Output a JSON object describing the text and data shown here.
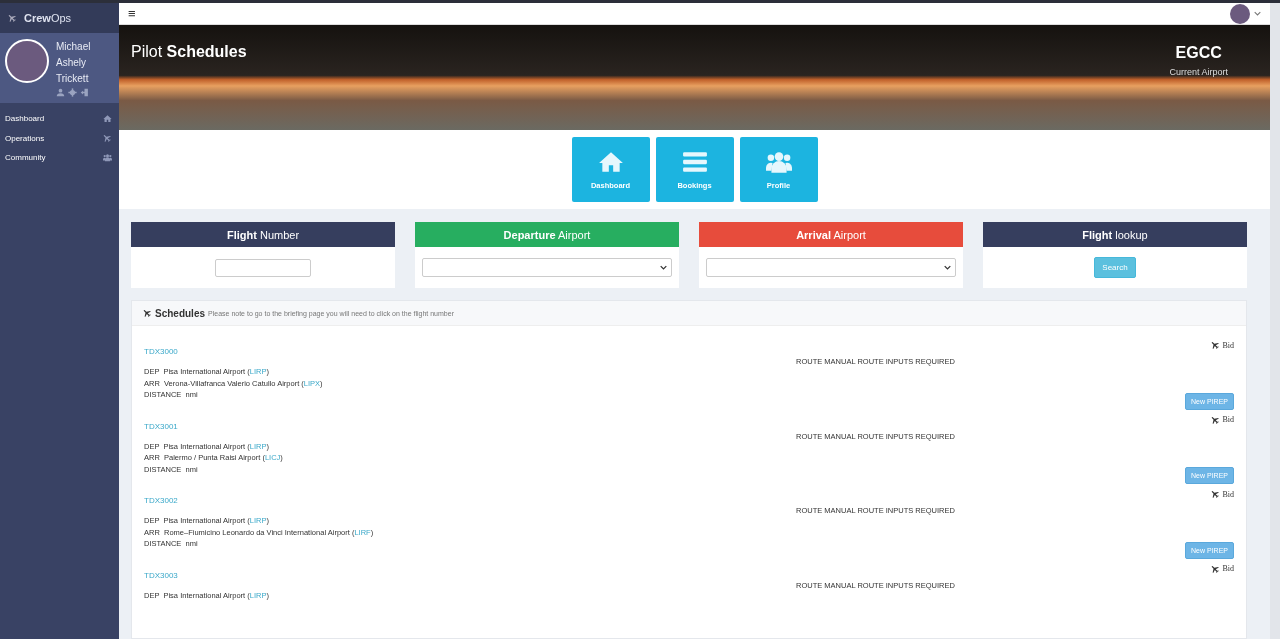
{
  "sidebar": {
    "brand": "**Crew**Ops",
    "user": {
      "name": "Michael Ashely Trickett"
    },
    "nav": [
      {
        "label": "Dashboard"
      },
      {
        "label": "Operations"
      },
      {
        "label": "Community"
      }
    ]
  },
  "topbar": {
    "menu": "≡"
  },
  "hero": {
    "title": "Pilot **Schedules**",
    "airport": "EGCC",
    "airport_label": "Current Airport"
  },
  "tiles": [
    {
      "label": "Dashboard"
    },
    {
      "label": "Bookings"
    },
    {
      "label": "Profile"
    }
  ],
  "filters": [
    {
      "title": "**Flight** Number",
      "color": "#363e5e",
      "kind": "input"
    },
    {
      "title": "**Departure** Airport",
      "color": "#27ae60",
      "kind": "select"
    },
    {
      "title": "**Arrival** Airport",
      "color": "#e74c3c",
      "kind": "select"
    },
    {
      "title": "**Flight** lookup",
      "color": "#363e5e",
      "kind": "button",
      "button": "Search"
    }
  ],
  "schedules": {
    "title": "Schedules",
    "note": "Please note to go to the briefing page you will need to click on the flight number",
    "flights": [
      {
        "number": "TDX3000",
        "dep": {
          "text": "DEP  Pisa International Airport (",
          "code": "LIRP",
          "end": ")"
        },
        "arr": {
          "text": "ARR  Verona-Villafranca Valerio Catullo Airport (",
          "code": "LIPX",
          "end": ")"
        },
        "distance": "DISTANCE  nmi",
        "route": "ROUTE  MANUAL ROUTE INPUTS REQUIRED",
        "bid": "Bid",
        "pirep": "New PIREP"
      },
      {
        "number": "TDX3001",
        "dep": {
          "text": "DEP  Pisa International Airport (",
          "code": "LIRP",
          "end": ")"
        },
        "arr": {
          "text": "ARR  Palermo / Punta Raisi Airport (",
          "code": "LICJ",
          "end": ")"
        },
        "distance": "DISTANCE  nmi",
        "route": "ROUTE  MANUAL ROUTE INPUTS REQUIRED",
        "bid": "Bid",
        "pirep": "New PIREP"
      },
      {
        "number": "TDX3002",
        "dep": {
          "text": "DEP  Pisa International Airport (",
          "code": "LIRP",
          "end": ")"
        },
        "arr": {
          "text": "ARR  Rome–Fiumicino Leonardo da Vinci International Airport (",
          "code": "LIRF",
          "end": ")"
        },
        "distance": "DISTANCE  nmi",
        "route": "ROUTE  MANUAL ROUTE INPUTS REQUIRED",
        "bid": "Bid",
        "pirep": "New PIREP"
      },
      {
        "number": "TDX3003",
        "dep": {
          "text": "DEP  Pisa International Airport (",
          "code": "LIRP",
          "end": ")"
        },
        "route": "ROUTE  MANUAL ROUTE INPUTS REQUIRED",
        "bid": "Bid"
      }
    ]
  }
}
